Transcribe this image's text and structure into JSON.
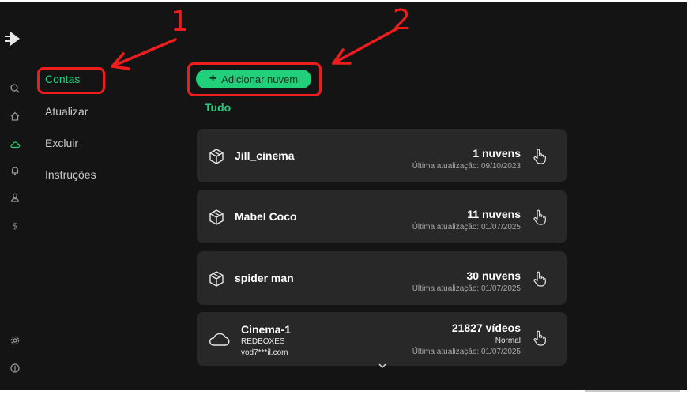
{
  "sidebar": {
    "items": [
      {
        "label": "Contas",
        "active": true
      },
      {
        "label": "Atualizar",
        "active": false
      },
      {
        "label": "Excluir",
        "active": false
      },
      {
        "label": "Instruções",
        "active": false
      }
    ],
    "rail_icons": [
      "search-icon",
      "home-icon",
      "cloud-icon",
      "bell-icon",
      "user-icon",
      "dollar-icon",
      "settings-icon",
      "help-icon"
    ]
  },
  "toolbar": {
    "add_label": "Adicionar nuvem",
    "add_icon": "+"
  },
  "tabs": {
    "all_label": "Tudo"
  },
  "accounts": [
    {
      "name": "Jill_cinema",
      "count": "1 nuvens",
      "updated": "Última atualização: 09/10/2023",
      "icon": "box-icon"
    },
    {
      "name": "Mabel Coco",
      "count": "11 nuvens",
      "updated": "Última atualização: 01/07/2025",
      "icon": "box-icon"
    },
    {
      "name": "spider man",
      "count": "30 nuvens",
      "updated": "Última atualização: 01/07/2025",
      "icon": "box-icon"
    },
    {
      "name": "Cinema-1",
      "line2": "REDBOXES",
      "line3": "vod7***il.com",
      "count": "21827 vídeos",
      "status": "Normal",
      "updated": "Última atualização: 01/07/2025",
      "icon": "cloud-icon"
    }
  ],
  "annotations": [
    {
      "label": "1"
    },
    {
      "label": "2"
    }
  ],
  "colors": {
    "accent": "#22d07c",
    "background": "#141414",
    "card": "#282828",
    "annotation": "#ee1d1d"
  }
}
